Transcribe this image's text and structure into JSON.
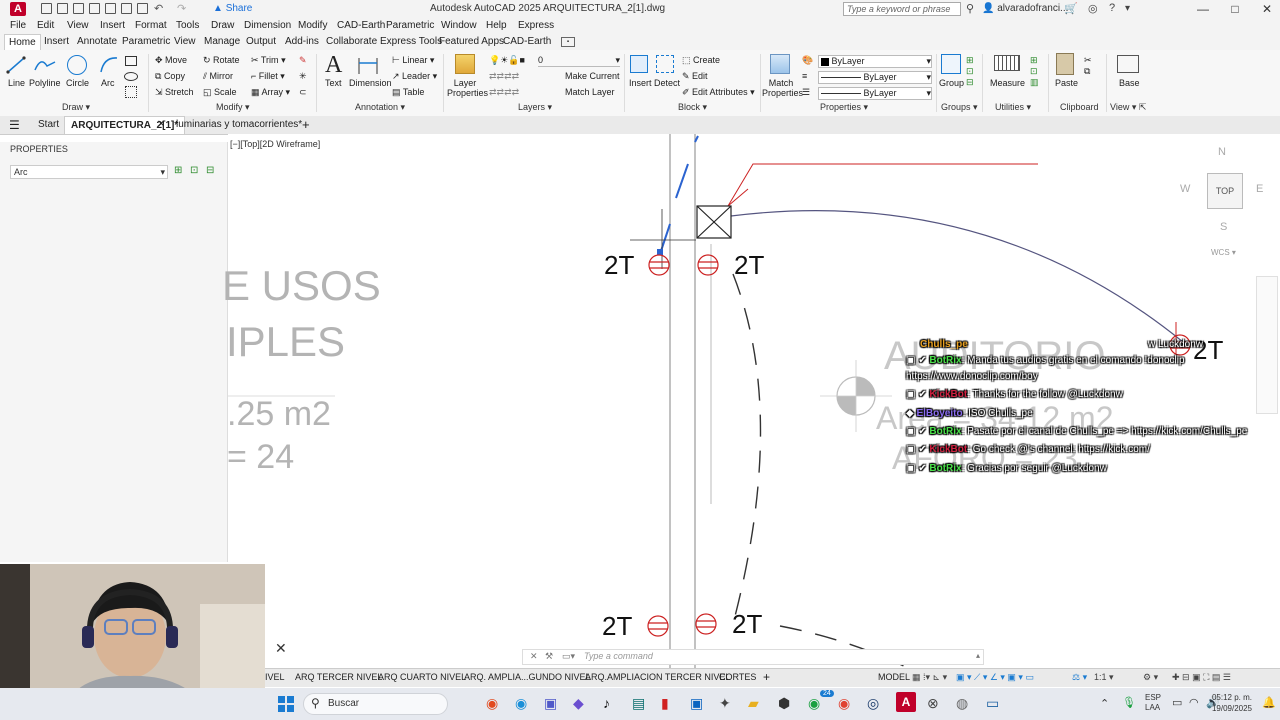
{
  "window": {
    "title": "Autodesk AutoCAD 2025    ARQUITECTURA_2[1].dwg",
    "share_label": "Share",
    "search_placeholder": "Type a keyword or phrase",
    "user": "alvaradofranci...",
    "controls": {
      "minimize": "—",
      "maximize": "□",
      "close": "✕"
    }
  },
  "menu": [
    "File",
    "Edit",
    "View",
    "Insert",
    "Format",
    "Tools",
    "Draw",
    "Dimension",
    "Modify",
    "CAD-Earth",
    "Parametric",
    "Window",
    "Help",
    "Express"
  ],
  "ribbon_tabs": [
    "Home",
    "Insert",
    "Annotate",
    "Parametric",
    "View",
    "Manage",
    "Output",
    "Add-ins",
    "Collaborate",
    "Express Tools",
    "Featured Apps",
    "CAD-Earth"
  ],
  "ribbon": {
    "draw": {
      "line": "Line",
      "polyline": "Polyline",
      "circle": "Circle",
      "arc": "Arc",
      "panel": "Draw"
    },
    "modify": {
      "move": "Move",
      "rotate": "Rotate",
      "trim": "Trim",
      "copy": "Copy",
      "mirror": "Mirror",
      "fillet": "Fillet",
      "stretch": "Stretch",
      "scale": "Scale",
      "array": "Array",
      "panel": "Modify"
    },
    "annotation": {
      "text": "Text",
      "dimension": "Dimension",
      "linear": "Linear",
      "leader": "Leader",
      "table": "Table",
      "panel": "Annotation"
    },
    "layers": {
      "layer_properties": "Layer Properties",
      "current_layer": "0",
      "make_current": "Make Current",
      "match_layer": "Match Layer",
      "panel": "Layers"
    },
    "block": {
      "insert": "Insert",
      "detect": "Detect",
      "create": "Create",
      "edit": "Edit",
      "edit_attributes": "Edit Attributes",
      "panel": "Block"
    },
    "properties": {
      "match": "Match Properties",
      "color": "ByLayer",
      "linetype": "ByLayer",
      "lineweight": "ByLayer",
      "panel": "Properties"
    },
    "groups": {
      "group": "Group",
      "panel": "Groups"
    },
    "utilities": {
      "measure": "Measure",
      "panel": "Utilities"
    },
    "clipboard": {
      "paste": "Paste",
      "panel": "Clipboard"
    },
    "view": {
      "base": "Base",
      "panel": "View"
    }
  },
  "doc_tabs": {
    "start": "Start",
    "active": "ARQUITECTURA_2[1]*",
    "other": "luminarias y tomacorrientes*"
  },
  "properties_panel": {
    "title": "PROPERTIES",
    "selection": "Arc"
  },
  "viewport": {
    "label": "[−][Top][2D Wireframe]",
    "texts": {
      "usos": "E USOS",
      "iples": "IPLES",
      "area": ".25 m2",
      "num": "= 24"
    },
    "outlet_label": "2T",
    "faded": {
      "auditorio": "AUDITORIO",
      "area2": "Area = 34.12 m2",
      "aforo": "AFORO = 23"
    },
    "viewcube": {
      "n": "N",
      "s": "S",
      "e": "E",
      "w": "W",
      "top": "TOP",
      "wcs": "WCS"
    }
  },
  "chat": [
    {
      "user": "Chulls_pe",
      "msg": ""
    },
    {
      "user": "BotRix",
      "msg": ": Manda tus audios gratis en el comando !donoclip"
    },
    {
      "user": "",
      "msg": "https://www.donoclip.com/boy"
    },
    {
      "user": "KickBot",
      "msg": ": Thanks for the follow @Luckdonw"
    },
    {
      "user": "ElBoyeito",
      "msg": ": ISO Chulls_pe"
    },
    {
      "user": "BotRix",
      "msg": ": Pasate por el canal de Chulls_pe => https://kick.com/Chulls_pe"
    },
    {
      "user": "KickBot",
      "msg": ": Go check @'s channel: https://kick.com/"
    },
    {
      "user": "BotRix",
      "msg": ": Gracias por seguir @Luckdonw"
    }
  ],
  "chat_corner_user": "w Luckdonw",
  "command_placeholder": "Type a command",
  "layout_tabs": [
    "IVEL",
    "ARQ TERCER NIVEL",
    "ARQ CUARTO NIVEL",
    "ARQ. AMPLIA...GUNDO NIVEL",
    "ARQ.AMPLIACION TERCER NIVEL",
    "CORTES"
  ],
  "status": {
    "model": "MODEL",
    "scale": "1:1"
  },
  "taskbar": {
    "search": "Buscar",
    "lang": "ESP",
    "region": "LAA",
    "time": "05:12 p. m.",
    "date": "19/09/2025",
    "badge": "24"
  },
  "colors": {
    "accent": "#1a7bd1",
    "app_red": "#c0002a",
    "outlet_red": "#cc2222"
  }
}
